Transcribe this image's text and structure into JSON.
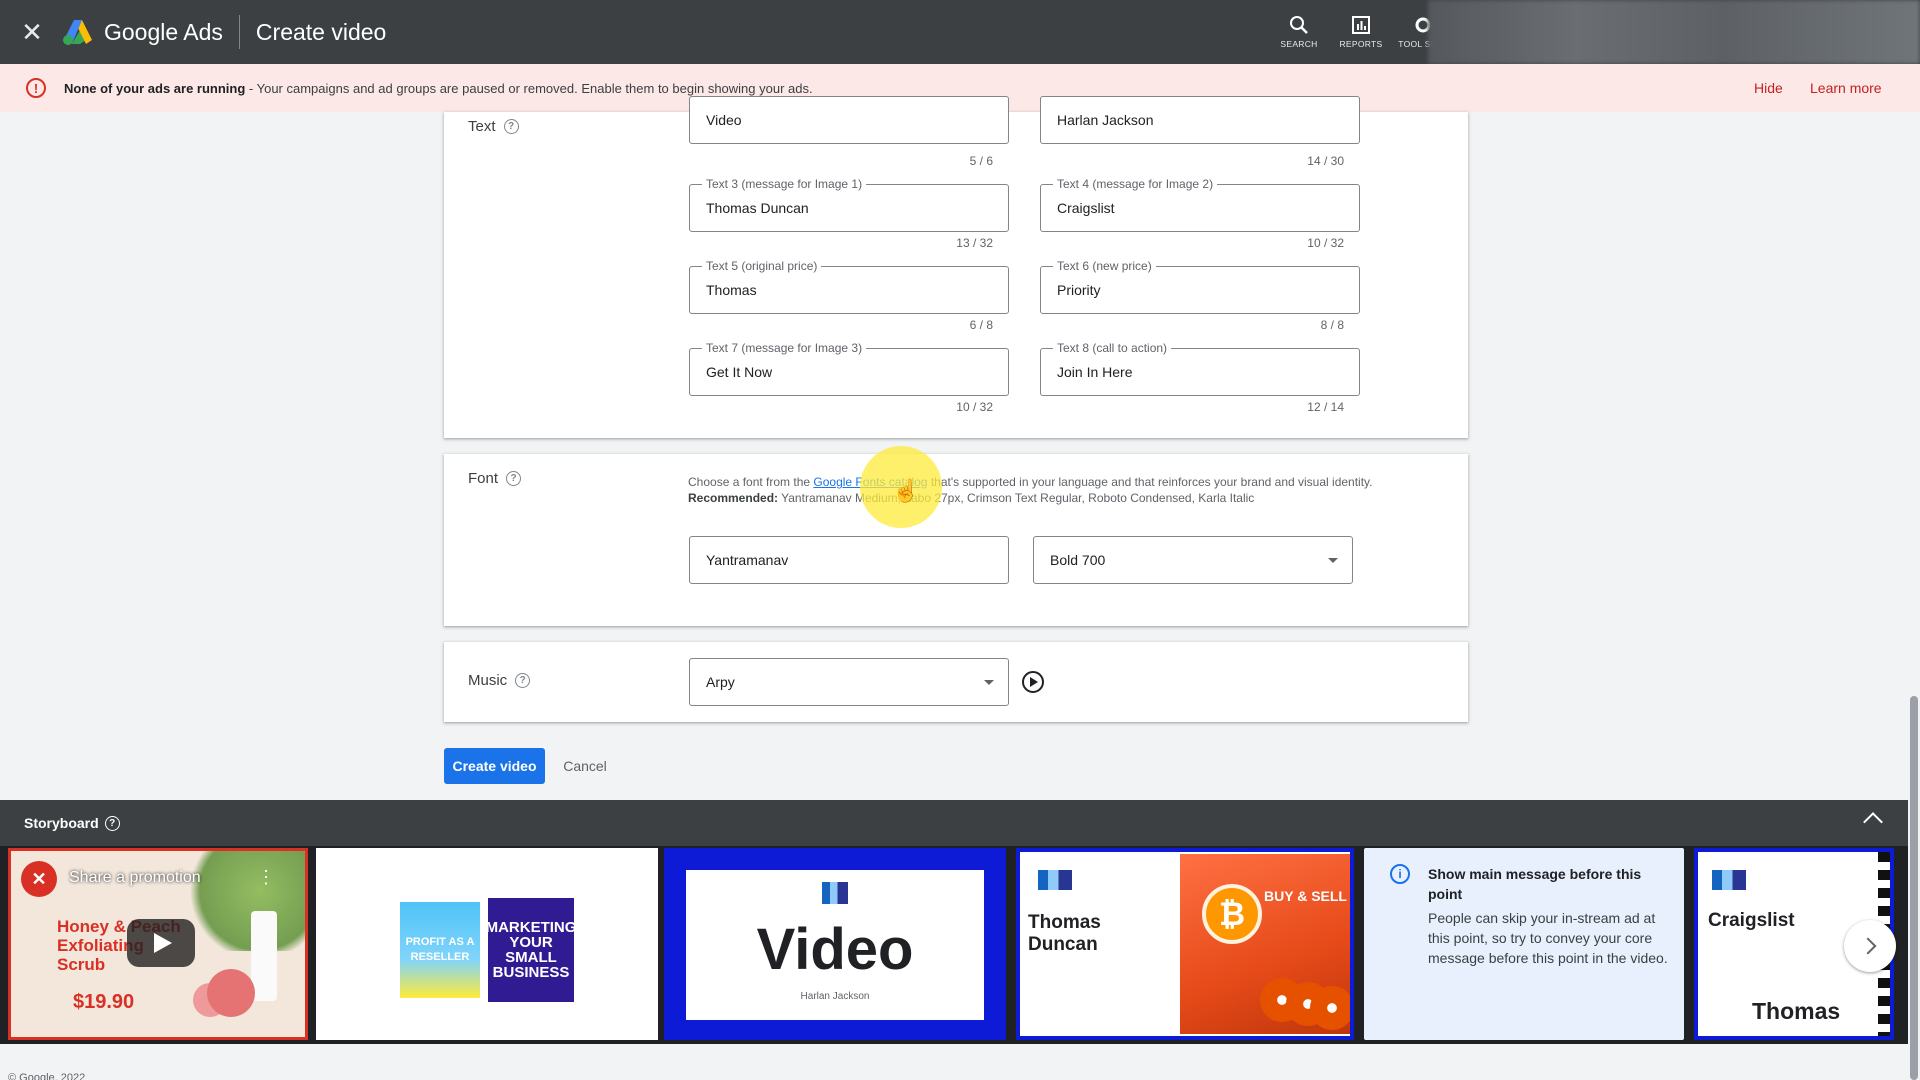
{
  "header": {
    "brand": "Google Ads",
    "page_title": "Create video",
    "actions": [
      {
        "label": "SEARCH",
        "icon": "search-icon"
      },
      {
        "label": "REPORTS",
        "icon": "reports-icon"
      },
      {
        "label": "TOOL SETT",
        "icon": "tools-icon"
      }
    ]
  },
  "alert": {
    "title": "None of your ads are running",
    "message": " - Your campaigns and ad groups are paused or removed. Enable them to begin showing your ads.",
    "hide": "Hide",
    "learn_more": "Learn more"
  },
  "text_section": {
    "label": "Text",
    "fields": [
      {
        "label": "",
        "value": "Video",
        "count": "5 / 6"
      },
      {
        "label": "",
        "value": "Harlan Jackson",
        "count": "14 / 30"
      },
      {
        "label": "Text 3 (message for Image 1)",
        "value": "Thomas Duncan",
        "count": "13 / 32"
      },
      {
        "label": "Text 4 (message for Image 2)",
        "value": "Craigslist",
        "count": "10 / 32"
      },
      {
        "label": "Text 5 (original price)",
        "value": "Thomas",
        "count": "6 / 8"
      },
      {
        "label": "Text 6 (new price)",
        "value": "Priority",
        "count": "8 / 8"
      },
      {
        "label": "Text 7 (message for Image 3)",
        "value": "Get It Now",
        "count": "10 / 32"
      },
      {
        "label": "Text 8 (call to action)",
        "value": "Join In Here",
        "count": "12 / 14"
      }
    ]
  },
  "font_section": {
    "label": "Font",
    "help_prefix": "Choose a font from the ",
    "help_link": "Google Fonts catalog",
    "help_suffix": " that's supported in your language and that reinforces your brand and visual identity.",
    "recommended_label": "Recommended:",
    "recommended_value": " Yantramanav Medium, Itabo 27px, Crimson Text Regular, Roboto Condensed, Karla Italic",
    "font_value": "Yantramanav",
    "weight_value": "Bold 700"
  },
  "music_section": {
    "label": "Music",
    "value": "Arpy"
  },
  "buttons": {
    "create": "Create video",
    "cancel": "Cancel"
  },
  "storyboard": {
    "title": "Storyboard",
    "frame1": {
      "title": "Share a promotion",
      "product": "Honey & Peach Exfoliating Scrub",
      "price": "$19.90"
    },
    "frame2": {
      "book1": "PROFIT AS A RESELLER",
      "book2": "MARKETING YOUR SMALL BUSINESS"
    },
    "frame3": {
      "big": "Video",
      "small": "Harlan Jackson"
    },
    "frame4": {
      "name": "Thomas Duncan",
      "buy_sell": "BUY & SELL"
    },
    "frame5": {
      "title": "Show main message before this point",
      "body": "People can skip your in-stream ad at this point, so try to convey your core message before this point in the video."
    },
    "frame6": {
      "title": "Craigslist",
      "sub": "Thomas"
    }
  },
  "footer": "© Google, 2022"
}
